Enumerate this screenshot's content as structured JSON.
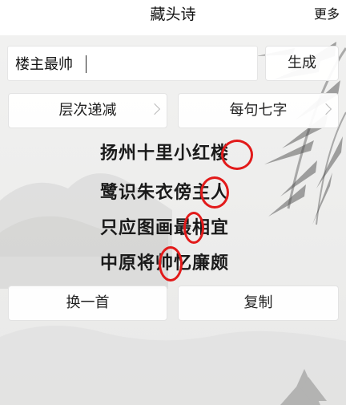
{
  "header": {
    "title": "藏头诗",
    "more_label": "更多"
  },
  "input": {
    "value": "楼主最帅"
  },
  "buttons": {
    "generate": "生成",
    "mode_select": "层次递减",
    "length_select": "每句七字",
    "another": "换一首",
    "copy": "复制"
  },
  "poem": {
    "lines": [
      "扬州十里小红楼",
      "鹭识朱衣傍主人",
      "只应图画最相宜",
      "中原将帅忆廉颇"
    ],
    "highlighted_chars": [
      "楼",
      "主",
      "最",
      "帅"
    ],
    "highlight_color": "#e21a1a"
  },
  "colors": {
    "header_bg": "#ffffff",
    "background": "#eeeeed",
    "text": "#1a1a1a"
  },
  "icons": {
    "chevron": "chevron-right-icon"
  }
}
